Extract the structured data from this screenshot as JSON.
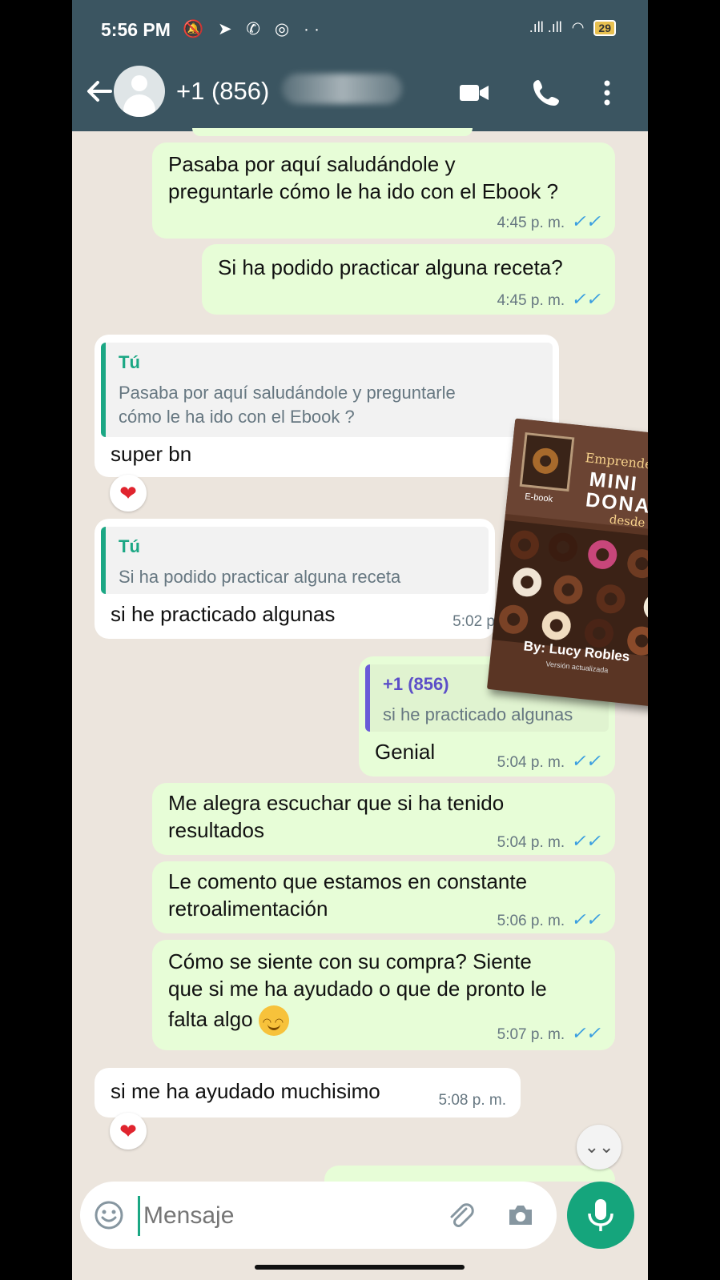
{
  "status_bar": {
    "time": "5:56 PM",
    "left_icons": "🔕 ➤ ✆ ◎ ··",
    "signal": ".ıll .ıll",
    "wifi": "◠",
    "battery": "29"
  },
  "header": {
    "contact_name": "+1 (856)",
    "icons": [
      "back-arrow-icon",
      "avatar-icon",
      "video-call-icon",
      "phone-call-icon",
      "more-vert-icon"
    ]
  },
  "messages": [
    {
      "type": "out",
      "text_lines": [
        "Pasaba por aquí saludándole y",
        "preguntarle cómo le ha ido con el Ebook ?"
      ],
      "time": "4:45 p. m.",
      "ticks": "✓✓"
    },
    {
      "type": "out",
      "text_lines": [
        "Si ha podido practicar alguna receta?"
      ],
      "time": "4:45 p. m.",
      "ticks": "✓✓"
    },
    {
      "type": "in",
      "quote_name": "Tú",
      "quote_lines": [
        "Pasaba por aquí saludándole y preguntarle",
        "cómo le ha ido con el Ebook ?"
      ],
      "text": "super bn",
      "reaction": "❤"
    },
    {
      "type": "in",
      "quote_name": "Tú",
      "quote_lines": [
        "Si ha podido practicar alguna receta"
      ],
      "text": "si he practicado algunas",
      "time": "5:02 p"
    },
    {
      "type": "out",
      "quote_name": "+1 (856)",
      "quote_lines": [
        "si he practicado algunas"
      ],
      "text": "Genial",
      "time": "5:04 p. m.",
      "ticks": "✓✓"
    },
    {
      "type": "out",
      "text_lines": [
        "Me alegra escuchar que si ha tenido",
        "resultados"
      ],
      "time": "5:04 p. m.",
      "ticks": "✓✓"
    },
    {
      "type": "out",
      "text_lines": [
        "Le comento que estamos en constante",
        "retroalimentación"
      ],
      "time": "5:06 p. m.",
      "ticks": "✓✓"
    },
    {
      "type": "out",
      "text_lines": [
        "Cómo se siente con su compra? Siente",
        "que si me ha ayudado o que de pronto le",
        "falta algo"
      ],
      "time": "5:07 p. m.",
      "ticks": "✓✓"
    },
    {
      "type": "in",
      "text": "si me ha ayudado muchisimo",
      "time": "5:08 p. m.",
      "reaction": "❤"
    }
  ],
  "ebook": {
    "label": "E-book",
    "title_line1": "Emprende con",
    "title_line2": "MINI",
    "title_line3": "DONAS",
    "title_line4": "desde casa",
    "author": "By: Lucy Robles",
    "version": "Versión actualizada"
  },
  "composer": {
    "placeholder": "Mensaje",
    "scroll_down_glyph": "⌄⌄"
  },
  "colors": {
    "header_bg": "#3b5561",
    "chat_bg": "#ece5dd",
    "outgoing_bubble": "#e7fdd7",
    "incoming_bubble": "#ffffff",
    "accent_green": "#15a57c",
    "read_ticks": "#3a9ee0",
    "reaction_heart": "#e0242e"
  }
}
